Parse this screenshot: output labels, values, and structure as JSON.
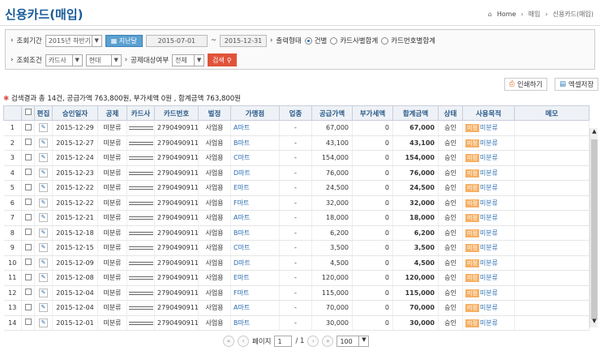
{
  "header": {
    "title": "신용카드(매입)",
    "breadcrumb": {
      "home": "Home",
      "parent": "매입",
      "current": "신용카드(매입)"
    }
  },
  "filter": {
    "period_label": "조회기간",
    "period_value": "2015년 하반기",
    "last_year_btn": "지난달",
    "date_from": "2015-07-01",
    "tilde": "~",
    "date_to": "2015-12-31",
    "output_label": "출력형태",
    "radio1": "건별",
    "radio2": "카드사별합계",
    "radio3": "카드번호별합계",
    "cond_label": "조회조건",
    "cond_value": "카드사",
    "cond_value2": "현대",
    "deduct_label": "공제대상여부",
    "deduct_value": "전체",
    "search_btn": "검색"
  },
  "summary": "검색결과 총 14건, 공급가액 763,800원, 부가세액 0원 , 합계금액 763,800원",
  "actions": {
    "print": "인쇄하기",
    "excel": "엑셀저장"
  },
  "columns": [
    "",
    "편집",
    "승인일자",
    "공제",
    "카드사",
    "카드번호",
    "벌정",
    "가맹점",
    "업종",
    "공급가액",
    "부가세액",
    "합계금액",
    "상태",
    "사용목적",
    "메모"
  ],
  "rows": [
    {
      "no": "1",
      "date": "2015-12-29",
      "deduct": "미분류",
      "cardno": "27904909114-",
      "bj": "사업용",
      "store": "A마트",
      "biz": "-",
      "supply": "67,000",
      "vat": "0",
      "total": "67,000",
      "status": "승인",
      "tag": "미정",
      "purpose": "미분류"
    },
    {
      "no": "2",
      "date": "2015-12-27",
      "deduct": "미분류",
      "cardno": "27904909114-",
      "bj": "사업용",
      "store": "B마트",
      "biz": "-",
      "supply": "43,100",
      "vat": "0",
      "total": "43,100",
      "status": "승인",
      "tag": "미정",
      "purpose": "미분류"
    },
    {
      "no": "3",
      "date": "2015-12-24",
      "deduct": "미분류",
      "cardno": "27904909114-",
      "bj": "사업용",
      "store": "C마트",
      "biz": "-",
      "supply": "154,000",
      "vat": "0",
      "total": "154,000",
      "status": "승인",
      "tag": "미정",
      "purpose": "미분류"
    },
    {
      "no": "4",
      "date": "2015-12-23",
      "deduct": "미분류",
      "cardno": "27904909114-",
      "bj": "사업용",
      "store": "D마트",
      "biz": "-",
      "supply": "76,000",
      "vat": "0",
      "total": "76,000",
      "status": "승인",
      "tag": "미정",
      "purpose": "미분류"
    },
    {
      "no": "5",
      "date": "2015-12-22",
      "deduct": "미분류",
      "cardno": "27904909114-",
      "bj": "사업용",
      "store": "E마트",
      "biz": "-",
      "supply": "24,500",
      "vat": "0",
      "total": "24,500",
      "status": "승인",
      "tag": "미정",
      "purpose": "미분류"
    },
    {
      "no": "6",
      "date": "2015-12-22",
      "deduct": "미분류",
      "cardno": "27904909114-",
      "bj": "사업용",
      "store": "F마트",
      "biz": "-",
      "supply": "32,000",
      "vat": "0",
      "total": "32,000",
      "status": "승인",
      "tag": "미정",
      "purpose": "미분류"
    },
    {
      "no": "7",
      "date": "2015-12-21",
      "deduct": "미분류",
      "cardno": "27904909114-",
      "bj": "사업용",
      "store": "A마트",
      "biz": "-",
      "supply": "18,000",
      "vat": "0",
      "total": "18,000",
      "status": "승인",
      "tag": "미정",
      "purpose": "미분류"
    },
    {
      "no": "8",
      "date": "2015-12-18",
      "deduct": "미분류",
      "cardno": "27904909114-",
      "bj": "사업용",
      "store": "B마트",
      "biz": "-",
      "supply": "6,200",
      "vat": "0",
      "total": "6,200",
      "status": "승인",
      "tag": "미정",
      "purpose": "미분류"
    },
    {
      "no": "9",
      "date": "2015-12-15",
      "deduct": "미분류",
      "cardno": "27904909114-",
      "bj": "사업용",
      "store": "C마트",
      "biz": "-",
      "supply": "3,500",
      "vat": "0",
      "total": "3,500",
      "status": "승인",
      "tag": "미정",
      "purpose": "미분류"
    },
    {
      "no": "10",
      "date": "2015-12-09",
      "deduct": "미분류",
      "cardno": "27904909114-",
      "bj": "사업용",
      "store": "D마트",
      "biz": "-",
      "supply": "4,500",
      "vat": "0",
      "total": "4,500",
      "status": "승인",
      "tag": "미정",
      "purpose": "미분류"
    },
    {
      "no": "11",
      "date": "2015-12-08",
      "deduct": "미분류",
      "cardno": "27904909114-",
      "bj": "사업용",
      "store": "E마트",
      "biz": "-",
      "supply": "120,000",
      "vat": "0",
      "total": "120,000",
      "status": "승인",
      "tag": "미정",
      "purpose": "미분류"
    },
    {
      "no": "12",
      "date": "2015-12-04",
      "deduct": "미분류",
      "cardno": "27904909114-",
      "bj": "사업용",
      "store": "F마트",
      "biz": "-",
      "supply": "115,000",
      "vat": "0",
      "total": "115,000",
      "status": "승인",
      "tag": "미정",
      "purpose": "미분류"
    },
    {
      "no": "13",
      "date": "2015-12-04",
      "deduct": "미분류",
      "cardno": "27904909114-",
      "bj": "사업용",
      "store": "A마트",
      "biz": "-",
      "supply": "70,000",
      "vat": "0",
      "total": "70,000",
      "status": "승인",
      "tag": "미정",
      "purpose": "미분류"
    },
    {
      "no": "14",
      "date": "2015-12-01",
      "deduct": "미분류",
      "cardno": "27904909114-",
      "bj": "사업용",
      "store": "B마트",
      "biz": "-",
      "supply": "30,000",
      "vat": "0",
      "total": "30,000",
      "status": "승인",
      "tag": "미정",
      "purpose": "미분류"
    }
  ],
  "pager": {
    "page_label": "페이지",
    "page": "1",
    "of": "/ 1",
    "per_page": "100"
  }
}
